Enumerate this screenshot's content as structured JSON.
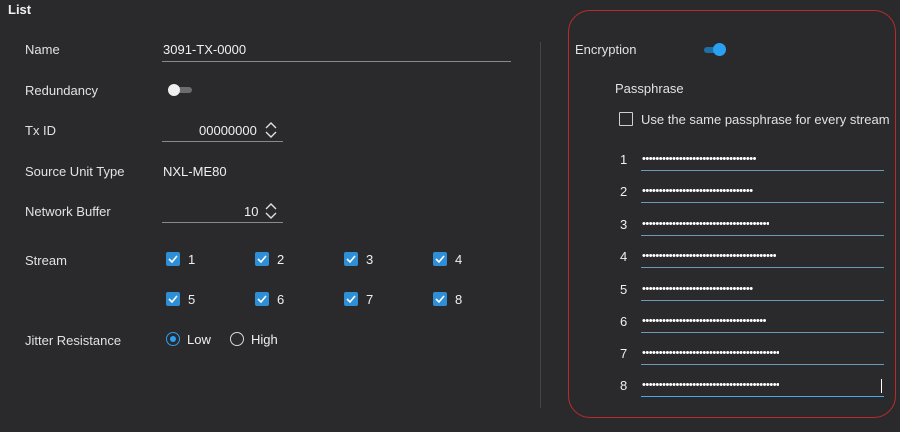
{
  "header": {
    "title": "List"
  },
  "form": {
    "name": {
      "label": "Name",
      "value": "3091-TX-0000"
    },
    "redundancy": {
      "label": "Redundancy",
      "enabled": false
    },
    "tx_id": {
      "label": "Tx ID",
      "value": "00000000"
    },
    "source_unit_type": {
      "label": "Source Unit Type",
      "value": "NXL-ME80"
    },
    "network_buffer": {
      "label": "Network Buffer",
      "value": "10"
    },
    "stream": {
      "label": "Stream",
      "items": [
        {
          "label": "1",
          "checked": true
        },
        {
          "label": "2",
          "checked": true
        },
        {
          "label": "3",
          "checked": true
        },
        {
          "label": "4",
          "checked": true
        },
        {
          "label": "5",
          "checked": true
        },
        {
          "label": "6",
          "checked": true
        },
        {
          "label": "7",
          "checked": true
        },
        {
          "label": "8",
          "checked": true
        }
      ]
    },
    "jitter": {
      "label": "Jitter Resistance",
      "options": [
        {
          "label": "Low",
          "selected": true
        },
        {
          "label": "High",
          "selected": false
        }
      ]
    }
  },
  "encryption": {
    "label": "Encryption",
    "enabled": true,
    "passphrase_label": "Passphrase",
    "same_passphrase_label": "Use the same passphrase for every stream",
    "same_passphrase_checked": false,
    "passphrases": [
      {
        "num": "1",
        "dots": "••••••••••••••••••••••••••••••••••"
      },
      {
        "num": "2",
        "dots": "•••••••••••••••••••••••••••••••••"
      },
      {
        "num": "3",
        "dots": "••••••••••••••••••••••••••••••••••••••"
      },
      {
        "num": "4",
        "dots": "••••••••••••••••••••••••••••••••••••••••"
      },
      {
        "num": "5",
        "dots": "•••••••••••••••••••••••••••••••••"
      },
      {
        "num": "6",
        "dots": "•••••••••••••••••••••••••••••••••••••"
      },
      {
        "num": "7",
        "dots": "•••••••••••••••••••••••••••••••••••••••••"
      },
      {
        "num": "8",
        "dots": "•••••••••••••••••••••••••••••••••••••••••"
      }
    ]
  },
  "colors": {
    "background": "#2a2a2c",
    "accent": "#2aa0f0",
    "highlight_border": "#b92c2c"
  }
}
